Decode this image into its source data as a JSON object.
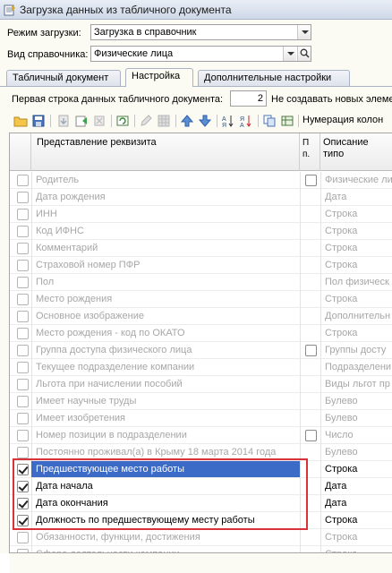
{
  "window": {
    "title": "Загрузка данных из табличного документа"
  },
  "form": {
    "mode_label": "Режим загрузки:",
    "mode_value": "Загрузка в справочник",
    "catalog_label": "Вид справочника:",
    "catalog_value": "Физические лица"
  },
  "tabs": [
    "Табличный документ",
    "Настройка",
    "Дополнительные настройки"
  ],
  "settings": {
    "first_row_label": "Первая строка данных табличного документа:",
    "first_row_value": "2",
    "no_create_label": "Не создавать новых элеме"
  },
  "toolbar": {
    "numbering_label": "Нумерация колон"
  },
  "grid": {
    "headers": {
      "attr": "Представление реквизита",
      "p": "П п.",
      "type": "Описание типо"
    },
    "rows": [
      {
        "checked": false,
        "name": "Родитель",
        "p_checkbox": true,
        "type": "Физические ли",
        "active": false
      },
      {
        "checked": false,
        "name": "Дата рождения",
        "p_checkbox": false,
        "type": "Дата",
        "active": false
      },
      {
        "checked": false,
        "name": "ИНН",
        "p_checkbox": false,
        "type": "Строка",
        "active": false
      },
      {
        "checked": false,
        "name": "Код ИФНС",
        "p_checkbox": false,
        "type": "Строка",
        "active": false
      },
      {
        "checked": false,
        "name": "Комментарий",
        "p_checkbox": false,
        "type": "Строка",
        "active": false
      },
      {
        "checked": false,
        "name": "Страховой номер ПФР",
        "p_checkbox": false,
        "type": "Строка",
        "active": false
      },
      {
        "checked": false,
        "name": "Пол",
        "p_checkbox": false,
        "type": "Пол физическ",
        "active": false
      },
      {
        "checked": false,
        "name": "Место рождения",
        "p_checkbox": false,
        "type": "Строка",
        "active": false
      },
      {
        "checked": false,
        "name": "Основное изображение",
        "p_checkbox": false,
        "type": "Дополнительн",
        "active": false
      },
      {
        "checked": false,
        "name": "Место рождения - код по ОКАТО",
        "p_checkbox": false,
        "type": "Строка",
        "active": false
      },
      {
        "checked": false,
        "name": "Группа доступа физического лица",
        "p_checkbox": true,
        "type": "Группы досту",
        "active": false
      },
      {
        "checked": false,
        "name": "Текущее подразделение компании",
        "p_checkbox": false,
        "type": "Подразделени",
        "active": false
      },
      {
        "checked": false,
        "name": "Льгота при начислении пособий",
        "p_checkbox": false,
        "type": "Виды льгот пр",
        "active": false
      },
      {
        "checked": false,
        "name": "Имеет научные труды",
        "p_checkbox": false,
        "type": "Булево",
        "active": false
      },
      {
        "checked": false,
        "name": "Имеет изобретения",
        "p_checkbox": false,
        "type": "Булево",
        "active": false
      },
      {
        "checked": false,
        "name": "Номер позиции в подразделении",
        "p_checkbox": true,
        "type": "Число",
        "active": false
      },
      {
        "checked": false,
        "name": "Постоянно проживал(а) в Крыму 18 марта 2014 года",
        "p_checkbox": false,
        "type": "Булево",
        "active": false
      },
      {
        "checked": true,
        "name": "Предшествующее место работы",
        "p_checkbox": false,
        "type": "Строка",
        "active": true,
        "selected": true
      },
      {
        "checked": true,
        "name": "Дата начала",
        "p_checkbox": false,
        "type": "Дата",
        "active": true
      },
      {
        "checked": true,
        "name": "Дата окончания",
        "p_checkbox": false,
        "type": "Дата",
        "active": true
      },
      {
        "checked": true,
        "name": "Должность по предшествующему месту работы",
        "p_checkbox": false,
        "type": "Строка",
        "active": true
      },
      {
        "checked": false,
        "name": "Обязанности, функции, достижения",
        "p_checkbox": false,
        "type": "Строка",
        "active": false
      },
      {
        "checked": false,
        "name": "Сфера деятельности компании",
        "p_checkbox": false,
        "type": "Строка",
        "active": false
      }
    ]
  }
}
